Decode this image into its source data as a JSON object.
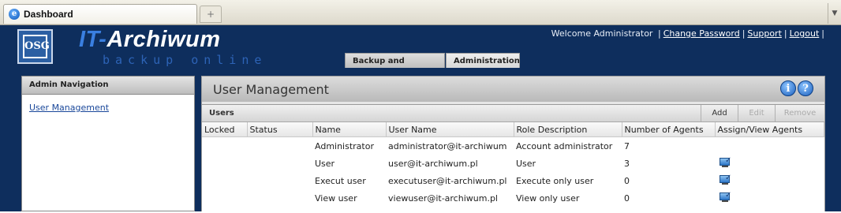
{
  "browser": {
    "tab_title": "Dashboard",
    "favicon": "ie-icon",
    "new_tab_symbol": "+",
    "tab_menu_symbol": "▼"
  },
  "header": {
    "logo_text": "OSG",
    "brand_prefix": "IT-",
    "brand_name": "Archiwum",
    "brand_sub": "backup online",
    "welcome": "Welcome Administrator",
    "links": [
      "Change Password",
      "Support",
      "Logout"
    ],
    "separator": "|",
    "tabs": [
      "Backup and Recovery",
      "Administration"
    ],
    "active_tab": "Administration",
    "colors": {
      "background": "#0e2e5d",
      "brand_accent": "#3a7fe0"
    }
  },
  "sidebar": {
    "title": "Admin Navigation",
    "items": [
      {
        "label": "User Management"
      }
    ]
  },
  "main": {
    "title": "User Management",
    "info_icon": "i",
    "help_icon": "?",
    "grid": {
      "title": "Users",
      "buttons": {
        "add": "Add",
        "edit": "Edit",
        "remove": "Remove"
      },
      "columns": [
        "Locked",
        "Status",
        "Name",
        "User Name",
        "Role Description",
        "Number of Agents",
        "Assign/View Agents"
      ],
      "rows": [
        {
          "locked": "",
          "status": "",
          "name": "Administrator",
          "username": "administrator@it-archiwum",
          "role": "Account administrator",
          "agents": "7",
          "assign_icon": false
        },
        {
          "locked": "",
          "status": "",
          "name": "User",
          "username": "user@it-archiwum.pl",
          "role": "User",
          "agents": "3",
          "assign_icon": true
        },
        {
          "locked": "",
          "status": "",
          "name": "Execut user",
          "username": "executuser@it-archiwum.pl",
          "role": "Execute only user",
          "agents": "0",
          "assign_icon": true
        },
        {
          "locked": "",
          "status": "",
          "name": "View user",
          "username": "viewuser@it-archiwum.pl",
          "role": "View only user",
          "agents": "0",
          "assign_icon": true
        }
      ]
    }
  }
}
